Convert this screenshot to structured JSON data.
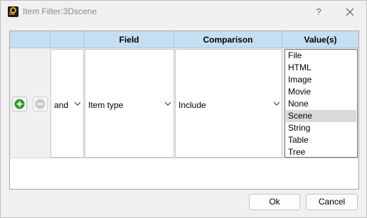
{
  "window": {
    "title": "Item Filter:3Dscene",
    "logo_text": "DB",
    "help_label": "?"
  },
  "table": {
    "columns": [
      "",
      "",
      "Field",
      "Comparison",
      "Value(s)"
    ],
    "rows": [
      {
        "connector": "and",
        "field": "Item type",
        "comparison": "Include",
        "values_options": [
          "File",
          "HTML",
          "Image",
          "Movie",
          "None",
          "Scene",
          "String",
          "Table",
          "Tree"
        ],
        "selected_value": "Scene"
      }
    ]
  },
  "icons": {
    "add": "plus-circle-icon",
    "remove": "minus-circle-icon",
    "close": "close-icon",
    "dropdown": "chevron-down-icon"
  },
  "colors": {
    "header_bg": "#c5dff2",
    "add_green": "#2e9b2e",
    "selected_item_bg": "#d9d9d9"
  },
  "footer": {
    "ok_label": "Ok",
    "cancel_label": "Cancel"
  }
}
